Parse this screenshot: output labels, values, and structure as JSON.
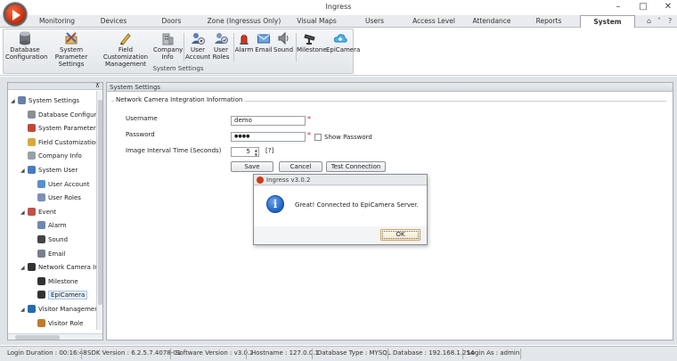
{
  "window": {
    "title": "Ingress"
  },
  "menu": {
    "tabs": [
      {
        "label": "Monitoring"
      },
      {
        "label": "Devices"
      },
      {
        "label": "Doors"
      },
      {
        "label": "Zone (Ingressus Only)"
      },
      {
        "label": "Visual Maps"
      },
      {
        "label": "Users"
      },
      {
        "label": "Access Level"
      },
      {
        "label": "Attendance"
      },
      {
        "label": "Reports"
      },
      {
        "label": "System Settings"
      }
    ],
    "active": "System Settings"
  },
  "ribbon": {
    "group_label": "System Settings",
    "buttons": [
      {
        "line1": "Database",
        "line2": "Configuration",
        "icon": "database-icon"
      },
      {
        "line1": "System Parameter",
        "line2": "Settings",
        "icon": "settings-icon"
      },
      {
        "line1": "Field Customization",
        "line2": "Management",
        "icon": "pencil-icon"
      },
      {
        "line1": "Company",
        "line2": "Info",
        "icon": "building-icon"
      },
      {
        "line1": "User",
        "line2": "Account",
        "icon": "user-icon"
      },
      {
        "line1": "User",
        "line2": "Roles",
        "icon": "user-roles-icon"
      },
      {
        "line1": "Alarm",
        "line2": "",
        "icon": "alarm-icon"
      },
      {
        "line1": "Email",
        "line2": "",
        "icon": "email-icon"
      },
      {
        "line1": "Sound",
        "line2": "",
        "icon": "sound-icon"
      },
      {
        "line1": "Milestone",
        "line2": "",
        "icon": "camera-icon"
      },
      {
        "line1": "EpiCamera",
        "line2": "",
        "icon": "cloud-camera-icon"
      }
    ]
  },
  "tree": {
    "items": [
      {
        "label": "System Settings",
        "level": 0,
        "exp": "◢"
      },
      {
        "label": "Database Configurat",
        "level": 1,
        "exp": ""
      },
      {
        "label": "System Parameter Se",
        "level": 1,
        "exp": ""
      },
      {
        "label": "Field Customization I",
        "level": 1,
        "exp": ""
      },
      {
        "label": "Company Info",
        "level": 1,
        "exp": ""
      },
      {
        "label": "System User",
        "level": 1,
        "exp": "◢"
      },
      {
        "label": "User Account",
        "level": 2,
        "exp": ""
      },
      {
        "label": "User Roles",
        "level": 2,
        "exp": ""
      },
      {
        "label": "Event",
        "level": 1,
        "exp": "◢"
      },
      {
        "label": "Alarm",
        "level": 2,
        "exp": ""
      },
      {
        "label": "Sound",
        "level": 2,
        "exp": ""
      },
      {
        "label": "Email",
        "level": 2,
        "exp": ""
      },
      {
        "label": "Network Camera Inte",
        "level": 1,
        "exp": "◢"
      },
      {
        "label": "Milestone",
        "level": 2,
        "exp": ""
      },
      {
        "label": "EpiCamera",
        "level": 2,
        "exp": "",
        "selected": true
      },
      {
        "label": "Visitor Management",
        "level": 1,
        "exp": "◢"
      },
      {
        "label": "Visitor Role",
        "level": 2,
        "exp": ""
      }
    ]
  },
  "content": {
    "header": "System Settings",
    "section_title": "Network Camera Integration Information",
    "username_label": "Username",
    "username_value": "demo",
    "password_label": "Password",
    "password_value": "●●●●",
    "show_password_label": "Show Password",
    "interval_label": "Image Interval Time (Seconds)",
    "interval_value": "5",
    "interval_hint": "[?]",
    "save_label": "Save",
    "cancel_label": "Cancel",
    "test_label": "Test Connection",
    "required_mark": "*"
  },
  "dialog": {
    "title": "Ingress v3.0.2",
    "message": "Great!  Connected to EpiCamera Server.",
    "ok_label": "OK",
    "icon_glyph": "i"
  },
  "status": {
    "login_duration": "Login Duration : 00:16:48",
    "sdk_version": "SDK Version : 6.2.5.7.4078-01",
    "software_version": "Software Version : v3.0.2",
    "hostname": "Hostname : 127.0.0.1",
    "database_type": "Database Type : MYSQL",
    "database": "Database : 192.168.1.254",
    "login_as": "Login As : admin"
  },
  "colors": {
    "accent": "#c52a0c",
    "selection": "#e5eef9",
    "required": "#dd2222"
  }
}
